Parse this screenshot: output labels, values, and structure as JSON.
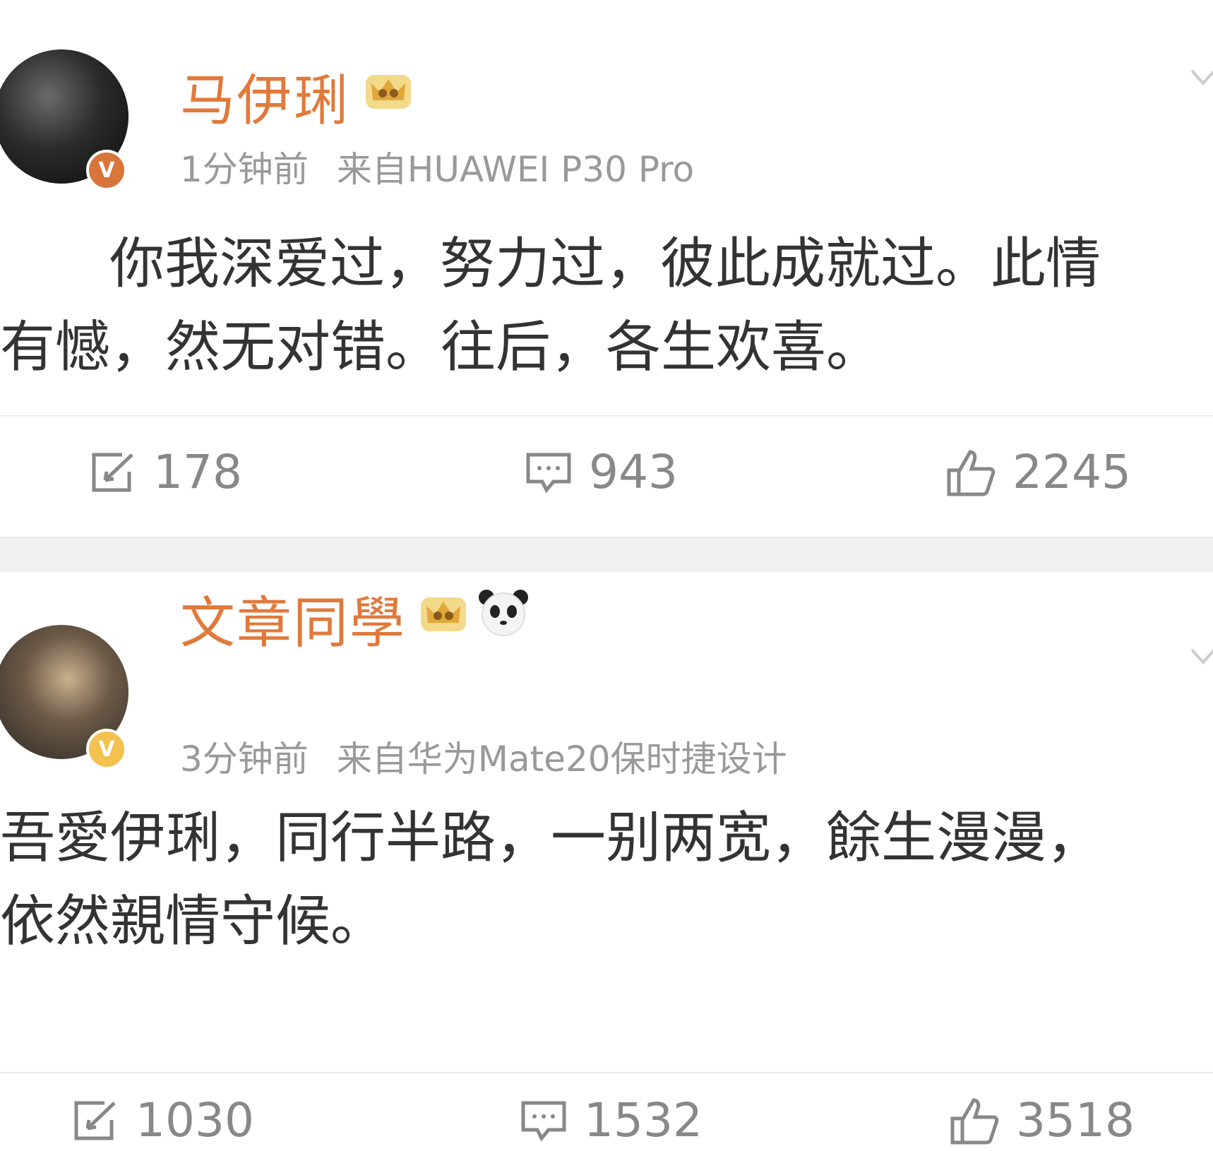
{
  "posts": [
    {
      "username": "马伊琍",
      "time": "1分钟前",
      "source": "来自HUAWEI P30 Pro",
      "content_lines": [
        "你我深爱过，努力过，彼此成就过。此情",
        "有憾，然无对错。往后，各生欢喜。"
      ],
      "reposts": "178",
      "comments": "943",
      "likes": "2245",
      "badge_color": "#d9743a"
    },
    {
      "username": "文章同學",
      "time": "3分钟前",
      "source": "来自华为Mate20保时捷设计",
      "content_lines": [
        "吾愛伊琍，同行半路，一别两宽，餘生漫漫，",
        "依然親情守候。"
      ],
      "reposts": "1030",
      "comments": "1532",
      "likes": "3518",
      "badge_color": "#f2c14e"
    }
  ],
  "badge_letter": "V",
  "icons": {
    "repost": "repost-icon",
    "comment": "comment-icon",
    "like": "thumbs-up-icon",
    "crown": "vip-crown-icon",
    "panda": "panda-icon",
    "menu": "chevron-down-icon"
  },
  "colors": {
    "username": "#e07a3c",
    "meta": "#999999",
    "text": "#333333",
    "action": "#888888"
  }
}
